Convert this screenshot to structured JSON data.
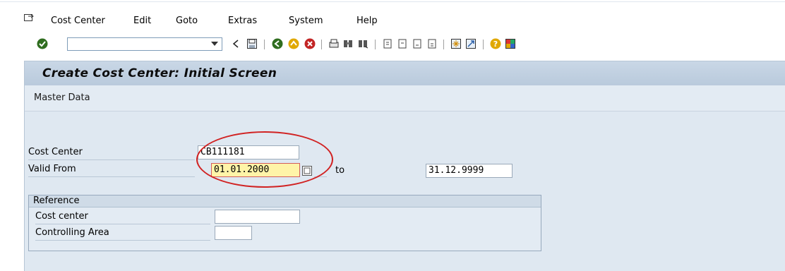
{
  "menubar": {
    "exit_icon": "exit-icon",
    "items": [
      {
        "label": "Cost Center"
      },
      {
        "label": "Edit"
      },
      {
        "label": "Goto"
      },
      {
        "label": "Extras"
      },
      {
        "label": "System"
      },
      {
        "label": "Help"
      }
    ]
  },
  "toolbar": {
    "command_field": {
      "value": "",
      "placeholder": ""
    },
    "icons": [
      "enter-icon",
      "back-arrow-icon",
      "save-icon",
      "back-icon",
      "exit-icon",
      "cancel-icon",
      "print-icon",
      "find-icon",
      "find-next-icon",
      "first-page-icon",
      "previous-page-icon",
      "next-page-icon",
      "last-page-icon",
      "create-session-icon",
      "shortcut-icon",
      "help-icon",
      "layout-menu-icon"
    ]
  },
  "screen": {
    "title": "Create Cost Center: Initial Screen",
    "app_toolbar": {
      "master_data": "Master Data"
    },
    "fields": {
      "cost_center_label": "Cost Center",
      "cost_center_value": "CB111181",
      "valid_from_label": "Valid From",
      "valid_from_value": "01.01.2000",
      "to_label": "to",
      "valid_to_value": "31.12.9999"
    },
    "reference": {
      "title": "Reference",
      "cost_center_label": "Cost center",
      "cost_center_value": "",
      "controlling_area_label": "Controlling Area",
      "controlling_area_value": ""
    }
  },
  "colors": {
    "highlight_circle": "#d12222",
    "screen_bg": "#dfe8f1",
    "required_field_bg": "#fff4a8"
  }
}
